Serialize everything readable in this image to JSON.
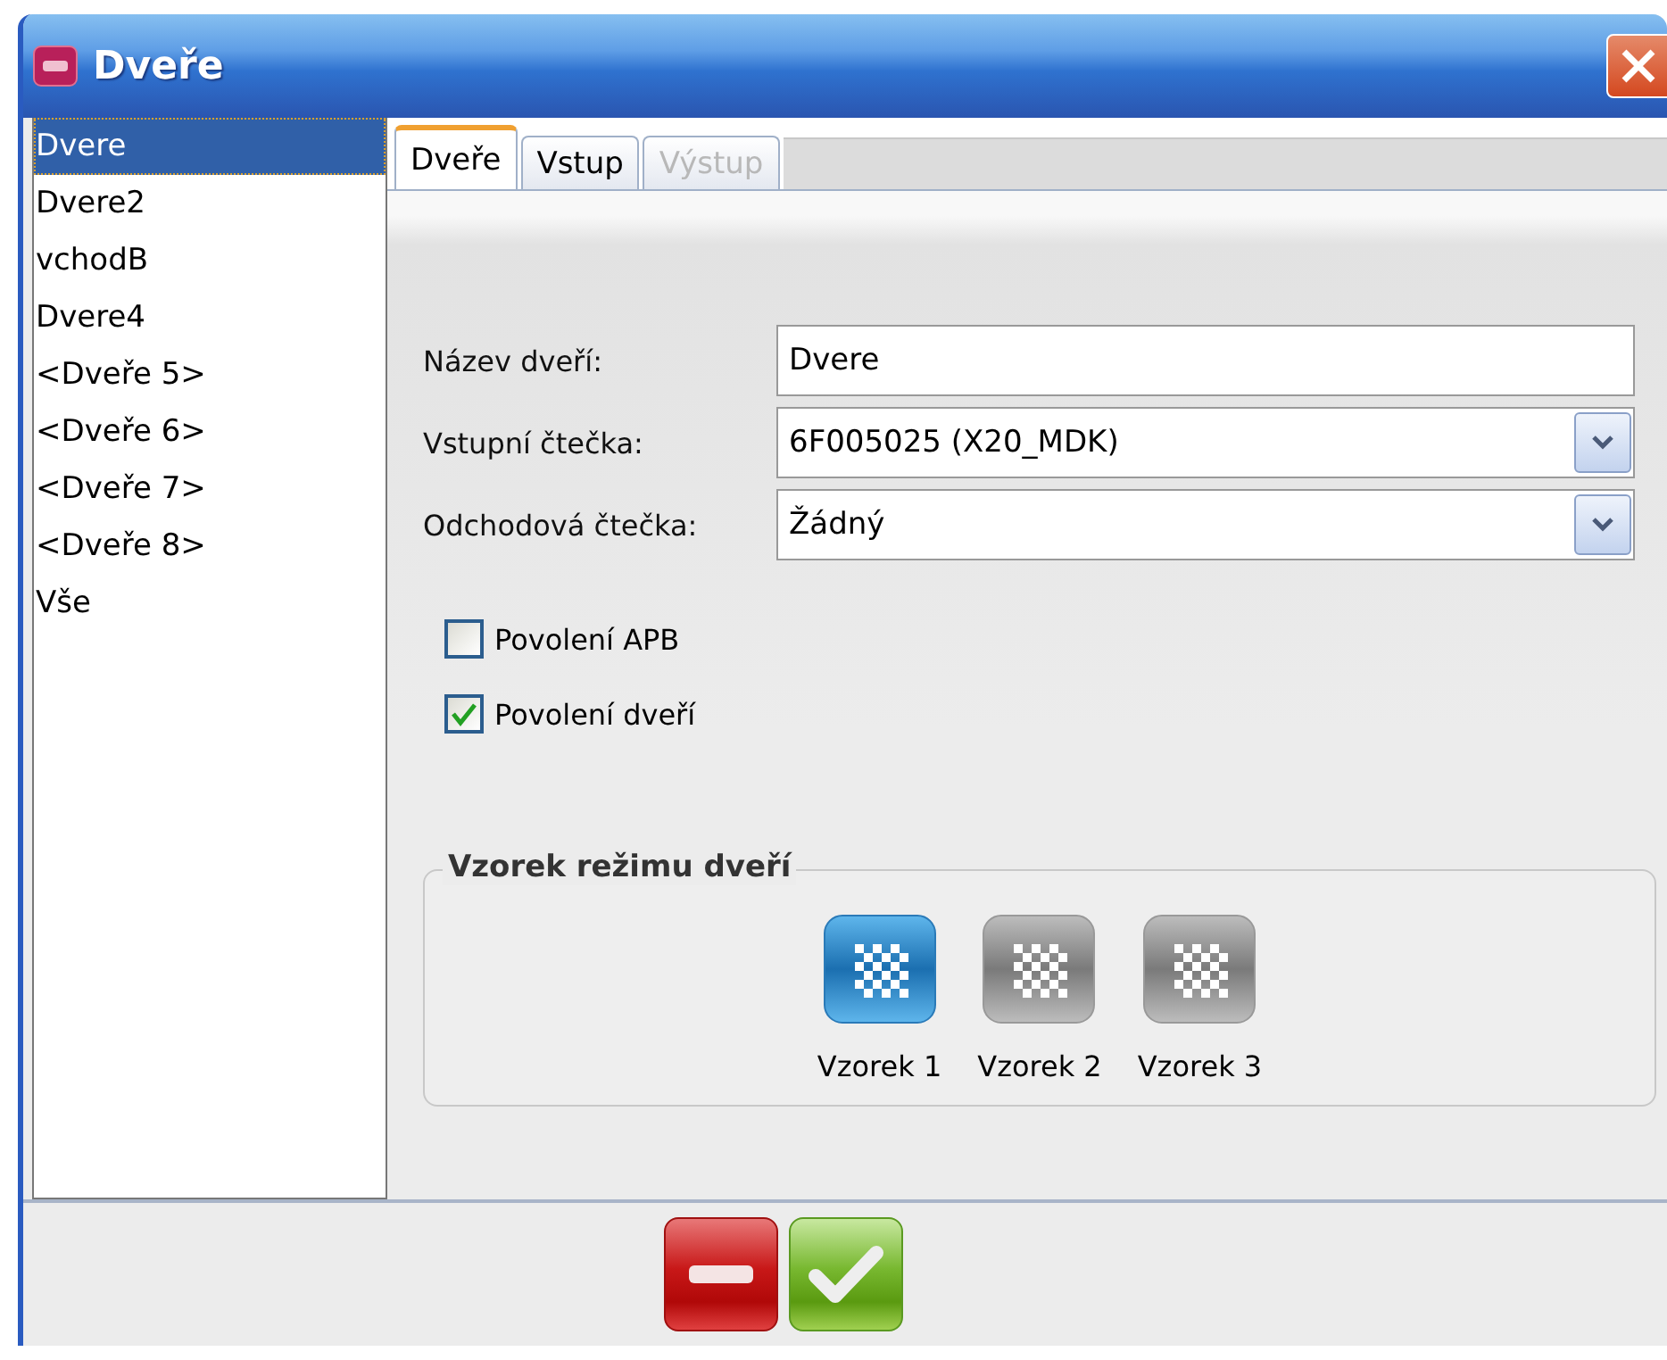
{
  "window": {
    "title": "Dveře"
  },
  "doors": [
    {
      "label": "Dvere",
      "selected": true
    },
    {
      "label": "Dvere2",
      "selected": false
    },
    {
      "label": "vchodB",
      "selected": false
    },
    {
      "label": "Dvere4",
      "selected": false
    },
    {
      "label": "<Dveře 5>",
      "selected": false
    },
    {
      "label": "<Dveře 6>",
      "selected": false
    },
    {
      "label": "<Dveře 7>",
      "selected": false
    },
    {
      "label": "<Dveře 8>",
      "selected": false
    },
    {
      "label": "Vše",
      "selected": false
    }
  ],
  "tabs": [
    {
      "label": "Dveře",
      "selected": true,
      "disabled": false
    },
    {
      "label": "Vstup",
      "selected": false,
      "disabled": false
    },
    {
      "label": "Výstup",
      "selected": false,
      "disabled": true
    }
  ],
  "fields": [
    {
      "kind": "text",
      "label": "Název dveří:",
      "value": "Dvere"
    },
    {
      "kind": "select",
      "label": "Vstupní čtečka:",
      "value": "6F005025 (X20_MDK)"
    },
    {
      "kind": "select",
      "label": "Odchodová čtečka:",
      "value": "Žádný"
    }
  ],
  "checkboxes": [
    {
      "label": "Povolení APB",
      "checked": false
    },
    {
      "label": "Povolení dveří",
      "checked": true
    }
  ],
  "pattern_group": {
    "title": "Vzorek režimu dveří",
    "patterns": [
      {
        "label": "Vzorek 1",
        "selected": true
      },
      {
        "label": "Vzorek 2",
        "selected": false
      },
      {
        "label": "Vzorek 3",
        "selected": false
      }
    ]
  }
}
